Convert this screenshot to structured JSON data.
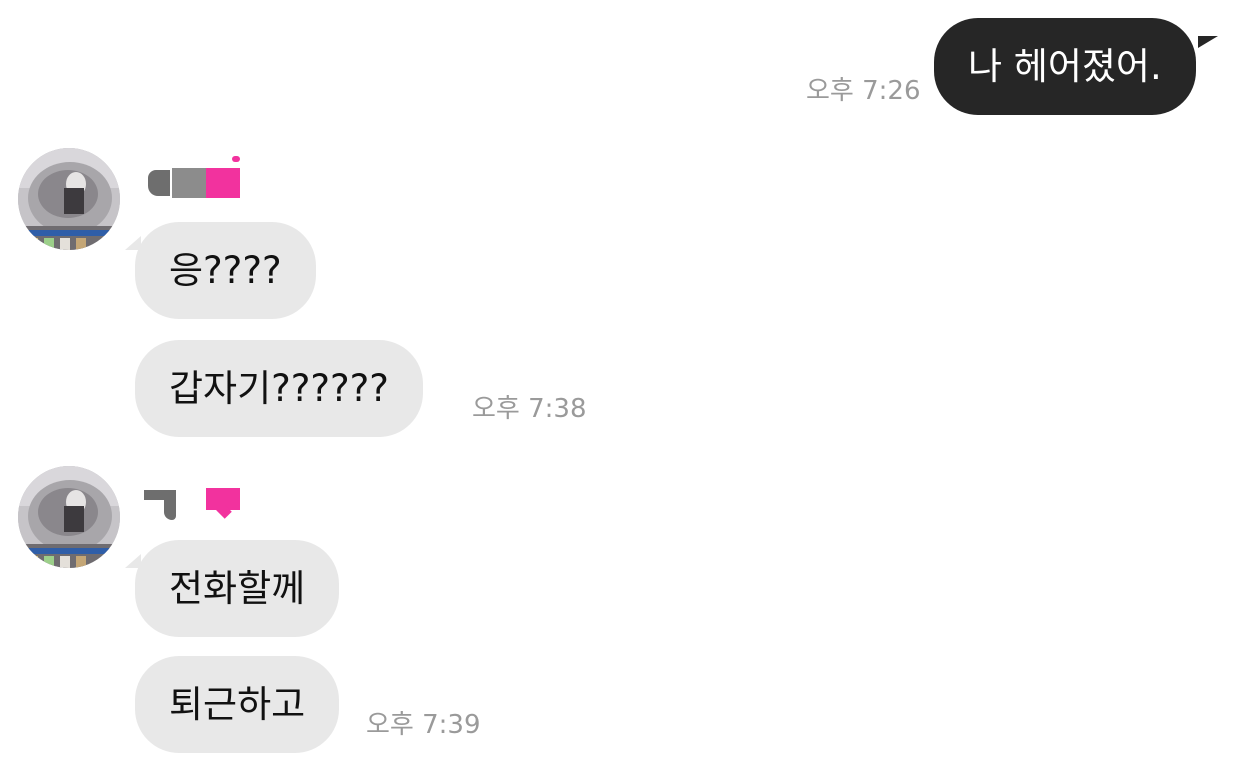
{
  "messages": [
    {
      "direction": "outgoing",
      "text": "나 헤어졌어.",
      "time": "오후 7:26"
    },
    {
      "direction": "incoming",
      "text": "응????"
    },
    {
      "direction": "incoming",
      "text": "갑자기??????",
      "time": "오후 7:38"
    },
    {
      "direction": "incoming",
      "text": "전화할께"
    },
    {
      "direction": "incoming",
      "text": "퇴근하고",
      "time": "오후 7:39"
    }
  ],
  "icons": {
    "avatar": "profile-photo-avatar",
    "sender_name": "redacted-name-censor"
  },
  "colors": {
    "outgoing_bubble": "#262626",
    "incoming_bubble": "#e8e8e8",
    "timestamp": "#9a9a9a",
    "censor_pink": "#f2329e",
    "background": "#ffffff"
  }
}
